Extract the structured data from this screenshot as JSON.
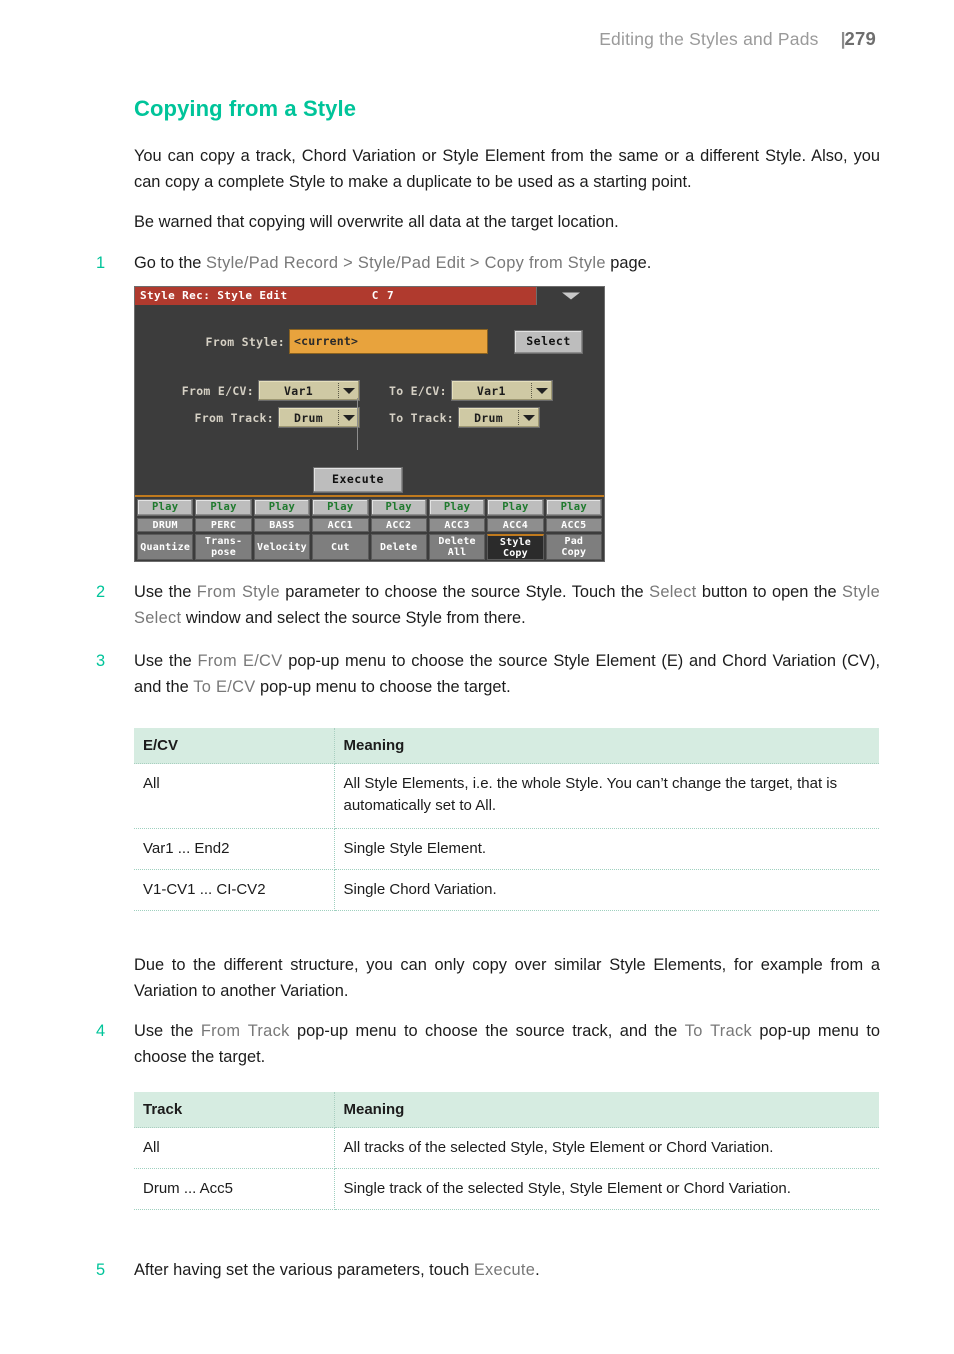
{
  "page_header": {
    "title": "Editing the Styles and Pads",
    "separator": "|",
    "page_number": "279"
  },
  "section": {
    "title": "Copying from a Style",
    "intro_paragraph_1": "You can copy a track, Chord Variation or Style Element from the same or a different Style. Also, you can copy a complete Style to make a duplicate to be used as a starting point.",
    "intro_paragraph_2": "Be warned that copying will overwrite all data at the target location.",
    "note_paragraph": "Due to the different structure, you can only copy over similar Style Elements, for example from a Variation to another Variation."
  },
  "steps": {
    "step1": {
      "number": "1",
      "text_before": "Go to the ",
      "path": "Style/Pad Record > Style/Pad Edit > Copy from Style",
      "text_after": " page."
    },
    "step2": {
      "number": "2",
      "p1": "Use the ",
      "t1": "From Style",
      "p2": " parameter to choose the source Style. Touch the ",
      "t2": "Select",
      "p3": " button to open the ",
      "t3": "Style Select",
      "p4": " window and select the source Style from there."
    },
    "step3": {
      "number": "3",
      "p1": "Use the ",
      "t1": "From E/CV",
      "p2": " pop-up menu to choose the source Style Element (E) and Chord Variation (CV), and the ",
      "t2": "To E/CV",
      "p3": " pop-up menu to choose the target."
    },
    "step4": {
      "number": "4",
      "p1": "Use the ",
      "t1": "From Track",
      "p2": " pop-up menu to choose the source track, and the ",
      "t2": "To Track",
      "p3": " pop-up menu to choose the target."
    },
    "step5": {
      "number": "5",
      "p1": "After having set the various parameters, touch ",
      "t1": "Execute",
      "p2": "."
    }
  },
  "device_screenshot": {
    "titlebar": {
      "title": "Style Rec: Style Edit",
      "chord": "C 7",
      "menu_icon": "chevron-down-icon"
    },
    "from_style": {
      "label": "From Style:",
      "value": "<current>",
      "select_button": "Select"
    },
    "from_ecv": {
      "label": "From E/CV:",
      "value": "Var1"
    },
    "to_ecv": {
      "label": "To E/CV:",
      "value": "Var1"
    },
    "from_track": {
      "label": "From Track:",
      "value": "Drum"
    },
    "to_track": {
      "label": "To Track:",
      "value": "Drum"
    },
    "execute_button": "Execute",
    "play_buttons": [
      "Play",
      "Play",
      "Play",
      "Play",
      "Play",
      "Play",
      "Play",
      "Play"
    ],
    "track_names": [
      "DRUM",
      "PERC",
      "BASS",
      "ACC1",
      "ACC2",
      "ACC3",
      "ACC4",
      "ACC5"
    ],
    "bottom_tabs": [
      {
        "label": "Quantize",
        "active": false
      },
      {
        "label": "Trans-\npose",
        "active": false
      },
      {
        "label": "Velocity",
        "active": false
      },
      {
        "label": "Cut",
        "active": false
      },
      {
        "label": "Delete",
        "active": false
      },
      {
        "label": "Delete\nAll",
        "active": false
      },
      {
        "label": "Style\nCopy",
        "active": true
      },
      {
        "label": "Pad\nCopy",
        "active": false
      }
    ]
  },
  "table_ecv": {
    "headers": [
      "E/CV",
      "Meaning"
    ],
    "rows": [
      [
        "All",
        "All Style Elements, i.e. the whole Style. You can’t change the target, that is automatically set to All."
      ],
      [
        "Var1 ... End2",
        "Single Style Element."
      ],
      [
        "V1-CV1 ... CI-CV2",
        "Single Chord Variation."
      ]
    ]
  },
  "table_track": {
    "headers": [
      "Track",
      "Meaning"
    ],
    "rows": [
      [
        "All",
        "All tracks of the selected Style, Style Element or Chord Variation."
      ],
      [
        "Drum ... Acc5",
        "Single track of the selected Style, Style Element or Chord Variation."
      ]
    ]
  },
  "colors": {
    "accent_teal": "#00c49a",
    "titlebar_red": "#b03a2e",
    "field_orange": "#e8a33d",
    "table_header_mint": "#d6ece1",
    "device_dark": "#3c3c3c",
    "combo_khaki": "#cfc9a4",
    "play_green": "#1f7a2e",
    "tab_accent_orange": "#c07a1e"
  }
}
